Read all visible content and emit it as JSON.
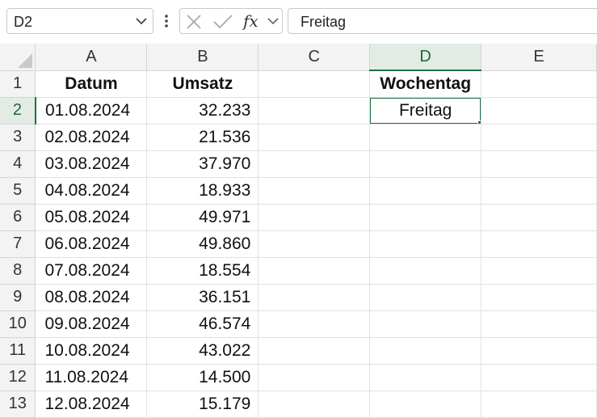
{
  "name_box": {
    "value": "D2"
  },
  "formula_bar": {
    "fx_label": "fx",
    "content": "Freitag"
  },
  "columns": [
    "A",
    "B",
    "C",
    "D",
    "E"
  ],
  "selected_column": "D",
  "selected_row": "2",
  "header_row": {
    "row": "1",
    "a": "Datum",
    "b": "Umsatz",
    "d": "Wochentag"
  },
  "rows": [
    {
      "row": "2",
      "date": "01.08.2024",
      "amount": "32.233",
      "d": "Freitag"
    },
    {
      "row": "3",
      "date": "02.08.2024",
      "amount": "21.536",
      "d": ""
    },
    {
      "row": "4",
      "date": "03.08.2024",
      "amount": "37.970",
      "d": ""
    },
    {
      "row": "5",
      "date": "04.08.2024",
      "amount": "18.933",
      "d": ""
    },
    {
      "row": "6",
      "date": "05.08.2024",
      "amount": "49.971",
      "d": ""
    },
    {
      "row": "7",
      "date": "06.08.2024",
      "amount": "49.860",
      "d": ""
    },
    {
      "row": "8",
      "date": "07.08.2024",
      "amount": "18.554",
      "d": ""
    },
    {
      "row": "9",
      "date": "08.08.2024",
      "amount": "36.151",
      "d": ""
    },
    {
      "row": "10",
      "date": "09.08.2024",
      "amount": "46.574",
      "d": ""
    },
    {
      "row": "11",
      "date": "10.08.2024",
      "amount": "43.022",
      "d": ""
    },
    {
      "row": "12",
      "date": "11.08.2024",
      "amount": "14.500",
      "d": ""
    },
    {
      "row": "13",
      "date": "12.08.2024",
      "amount": "15.179",
      "d": ""
    }
  ],
  "colors": {
    "accent": "#1e7145",
    "header_bg": "#f3f3f3",
    "selected_header_bg": "#e2ece4",
    "gridline": "#e1e1e1"
  },
  "icons": {
    "name_box_dropdown": "chevron-down-icon",
    "more": "more-vertical-icon",
    "cancel": "close-icon",
    "enter": "check-icon",
    "expand": "chevron-down-icon"
  }
}
